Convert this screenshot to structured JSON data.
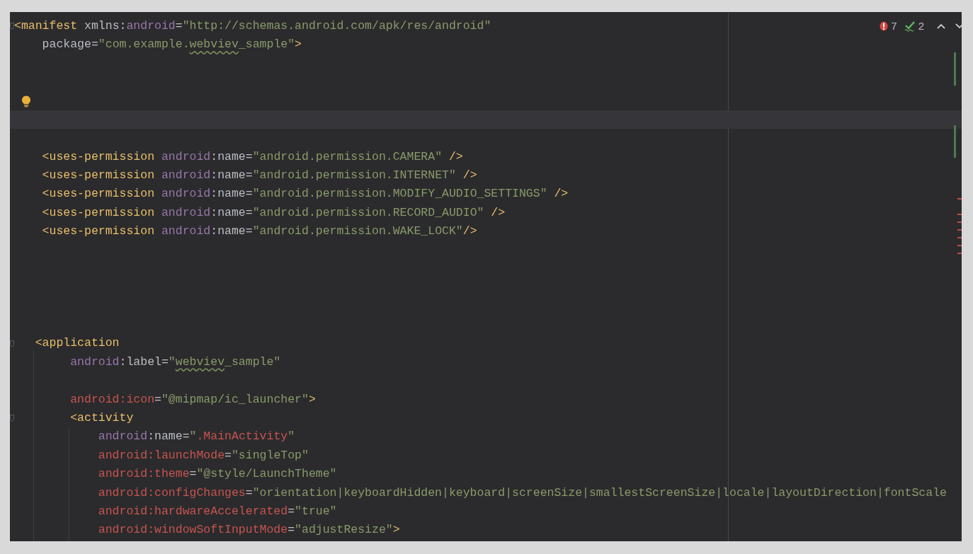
{
  "inspections": {
    "errors": "7",
    "warnings": "2"
  },
  "lines": [
    {
      "kind": "code",
      "marker": {
        "kind": "fold"
      },
      "tokens": [
        {
          "kind": "tag",
          "text": "<manifest"
        },
        {
          "kind": "plain",
          "text": " xmlns:"
        },
        {
          "kind": "ns",
          "text": "android"
        },
        {
          "kind": "plain",
          "text": "="
        },
        {
          "kind": "str",
          "text": "\"http://schemas.android.com/apk/res/android\""
        }
      ]
    },
    {
      "kind": "code",
      "tokens": [
        {
          "kind": "plain",
          "text": "    package"
        },
        {
          "kind": "plain",
          "text": "="
        },
        {
          "kind": "str",
          "text": "\"com.example."
        },
        {
          "kind": "typo",
          "text": "webviev"
        },
        {
          "kind": "str",
          "text": "_sample\""
        },
        {
          "kind": "tag",
          "text": ">"
        }
      ]
    },
    {
      "kind": "code"
    },
    {
      "kind": "code"
    },
    {
      "kind": "code",
      "marker": {
        "kind": "bulb"
      }
    },
    {
      "kind": "caret"
    },
    {
      "kind": "code"
    },
    {
      "kind": "code",
      "tokens": [
        {
          "kind": "tag",
          "text": "    <uses-permission"
        },
        {
          "kind": "ns",
          "text": " android"
        },
        {
          "kind": "plain",
          "text": ":name="
        },
        {
          "kind": "str",
          "text": "\"android.permission.CAMERA\""
        },
        {
          "kind": "tag",
          "text": " />"
        }
      ]
    },
    {
      "kind": "code",
      "tokens": [
        {
          "kind": "tag",
          "text": "    <uses-permission"
        },
        {
          "kind": "ns",
          "text": " android"
        },
        {
          "kind": "plain",
          "text": ":name="
        },
        {
          "kind": "str",
          "text": "\"android.permission.INTERNET\""
        },
        {
          "kind": "tag",
          "text": " />"
        }
      ]
    },
    {
      "kind": "code",
      "tokens": [
        {
          "kind": "tag",
          "text": "    <uses-permission"
        },
        {
          "kind": "ns",
          "text": " android"
        },
        {
          "kind": "plain",
          "text": ":name="
        },
        {
          "kind": "str",
          "text": "\"android.permission.MODIFY_AUDIO_SETTINGS\""
        },
        {
          "kind": "tag",
          "text": " />"
        }
      ]
    },
    {
      "kind": "code",
      "tokens": [
        {
          "kind": "tag",
          "text": "    <uses-permission"
        },
        {
          "kind": "ns",
          "text": " android"
        },
        {
          "kind": "plain",
          "text": ":name="
        },
        {
          "kind": "str",
          "text": "\"android.permission.RECORD_AUDIO\""
        },
        {
          "kind": "tag",
          "text": " />"
        }
      ]
    },
    {
      "kind": "code",
      "tokens": [
        {
          "kind": "tag",
          "text": "    <uses-permission"
        },
        {
          "kind": "ns",
          "text": " android"
        },
        {
          "kind": "plain",
          "text": ":name="
        },
        {
          "kind": "str",
          "text": "\"android.permission.WAKE_LOCK\""
        },
        {
          "kind": "tag",
          "text": "/>"
        }
      ]
    },
    {
      "kind": "code"
    },
    {
      "kind": "code"
    },
    {
      "kind": "code"
    },
    {
      "kind": "code"
    },
    {
      "kind": "code"
    },
    {
      "kind": "code",
      "marker": {
        "kind": "fold"
      },
      "tokens": [
        {
          "kind": "tag",
          "text": "   <application"
        }
      ]
    },
    {
      "kind": "code",
      "tokens": [
        {
          "kind": "ns",
          "text": "        android"
        },
        {
          "kind": "plain",
          "text": ":label="
        },
        {
          "kind": "str",
          "text": "\""
        },
        {
          "kind": "typo",
          "text": "webviev"
        },
        {
          "kind": "str",
          "text": "_sample\""
        }
      ]
    },
    {
      "kind": "code"
    },
    {
      "kind": "code",
      "tokens": [
        {
          "kind": "error",
          "text": "        android:icon"
        },
        {
          "kind": "plain",
          "text": "="
        },
        {
          "kind": "str",
          "text": "\"@mipmap/ic_launcher\""
        },
        {
          "kind": "tag",
          "text": ">"
        }
      ]
    },
    {
      "kind": "code",
      "marker": {
        "kind": "fold"
      },
      "tokens": [
        {
          "kind": "tag",
          "text": "        <activity"
        }
      ]
    },
    {
      "kind": "code",
      "tokens": [
        {
          "kind": "ns",
          "text": "            android"
        },
        {
          "kind": "plain",
          "text": ":name="
        },
        {
          "kind": "str",
          "text": "\""
        },
        {
          "kind": "error",
          "text": ".MainActivity"
        },
        {
          "kind": "str",
          "text": "\""
        }
      ]
    },
    {
      "kind": "code",
      "tokens": [
        {
          "kind": "error",
          "text": "            android:launchMode"
        },
        {
          "kind": "plain",
          "text": "="
        },
        {
          "kind": "str",
          "text": "\"singleTop\""
        }
      ]
    },
    {
      "kind": "code",
      "tokens": [
        {
          "kind": "error",
          "text": "            android:theme"
        },
        {
          "kind": "plain",
          "text": "="
        },
        {
          "kind": "str",
          "text": "\"@style/LaunchTheme\""
        }
      ]
    },
    {
      "kind": "code",
      "tokens": [
        {
          "kind": "error",
          "text": "            android:configChanges"
        },
        {
          "kind": "plain",
          "text": "="
        },
        {
          "kind": "str",
          "text": "\"orientation|keyboardHidden|keyboard|screenSize|smallestScreenSize|locale|layoutDirection|fontScale"
        }
      ]
    },
    {
      "kind": "code",
      "tokens": [
        {
          "kind": "error",
          "text": "            android:hardwareAccelerated"
        },
        {
          "kind": "plain",
          "text": "="
        },
        {
          "kind": "str",
          "text": "\"true\""
        }
      ]
    },
    {
      "kind": "code",
      "tokens": [
        {
          "kind": "error",
          "text": "            android:windowSoftInputMode"
        },
        {
          "kind": "plain",
          "text": "="
        },
        {
          "kind": "str",
          "text": "\"adjustResize\""
        },
        {
          "kind": "tag",
          "text": ">"
        }
      ]
    }
  ]
}
